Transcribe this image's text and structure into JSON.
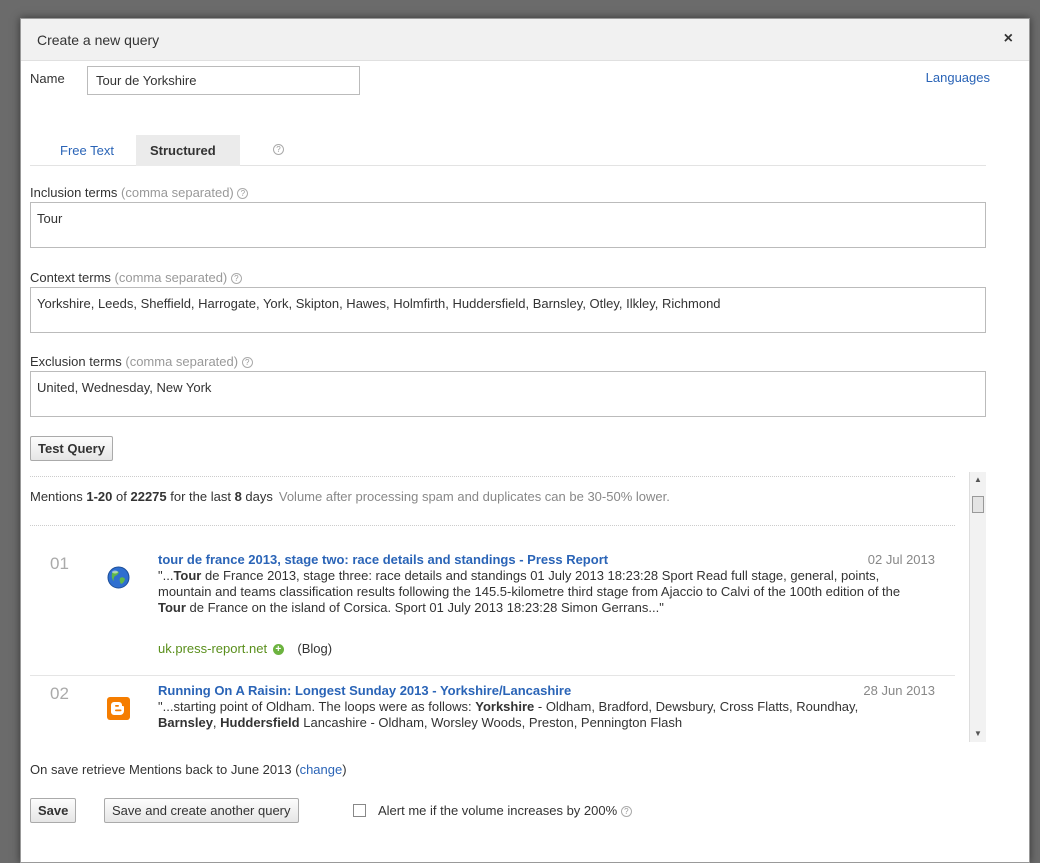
{
  "dialog": {
    "title": "Create a new query",
    "close_label": "×"
  },
  "name_row": {
    "label": "Name",
    "value": "Tour de Yorkshire",
    "languages_link": "Languages"
  },
  "tabs": [
    {
      "label": "Free Text",
      "active": false
    },
    {
      "label": "Structured",
      "active": true
    }
  ],
  "help_glyph": "?",
  "inclusion": {
    "label": "Inclusion terms",
    "hint": "(comma separated)",
    "value": "Tour"
  },
  "context": {
    "label": "Context terms",
    "hint": "(comma separated)",
    "value": "Yorkshire, Leeds, Sheffield, Harrogate, York, Skipton, Hawes, Holmfirth, Huddersfield, Barnsley, Otley, Ilkley, Richmond"
  },
  "exclusion": {
    "label": "Exclusion terms",
    "hint": "(comma separated)",
    "value": "United, Wednesday, New York"
  },
  "test_button": "Test Query",
  "mentions_summary": {
    "prefix": "Mentions ",
    "range": "1-20",
    "of": " of ",
    "total": "22275",
    "for": " for the last ",
    "days": "8",
    "days_suffix": " days",
    "note": "Volume after processing spam and duplicates can be 30-50% lower."
  },
  "results": [
    {
      "num": "01",
      "icon": "globe-icon",
      "title": "tour de france 2013, stage two: race details and standings - Press Report",
      "date": "02 Jul 2013",
      "snippet_parts": [
        {
          "t": "\"...",
          "b": false
        },
        {
          "t": "Tour",
          "b": true
        },
        {
          "t": " de France 2013, stage three: race details and standings 01 July 2013 18:23:28 Sport Read full stage, general, points, mountain and teams classification results following the 145.5-kilometre third stage from Ajaccio to Calvi of the 100th edition of the ",
          "b": false
        },
        {
          "t": "Tour",
          "b": true
        },
        {
          "t": " de France on the island of Corsica. Sport 01 July 2013 18:23:28 Simon Gerrans...\"",
          "b": false
        }
      ],
      "source": "uk.press-report.net",
      "type": "(Blog)"
    },
    {
      "num": "02",
      "icon": "blogger-icon",
      "title": "Running On A Raisin: Longest Sunday 2013 - Yorkshire/Lancashire",
      "date": "28 Jun 2013",
      "snippet_parts": [
        {
          "t": "\"...starting point of Oldham. The loops were as follows: ",
          "b": false
        },
        {
          "t": "Yorkshire",
          "b": true
        },
        {
          "t": " - Oldham, Bradford, Dewsbury, Cross Flatts, Roundhay, ",
          "b": false
        },
        {
          "t": "Barnsley",
          "b": true
        },
        {
          "t": ", ",
          "b": false
        },
        {
          "t": "Huddersfield",
          "b": true
        },
        {
          "t": " Lancashire - Oldham, Worsley Woods, Preston, Pennington Flash",
          "b": false
        }
      ],
      "source": "",
      "type": ""
    }
  ],
  "save_retrieve": {
    "text": "On save retrieve Mentions back to June 2013 ",
    "open": "(",
    "link": "change",
    "close": ")"
  },
  "buttons": {
    "save": "Save",
    "save_another": "Save and create another query"
  },
  "alert": {
    "label": "Alert me if the volume increases by 200%",
    "checked": false
  },
  "colors": {
    "link": "#2a64b7",
    "source_green": "#5a8f1c",
    "blogger_orange": "#f57d00"
  }
}
